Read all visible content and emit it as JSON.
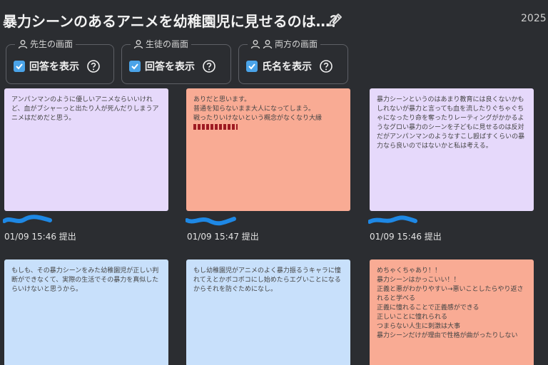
{
  "header": {
    "title": "暴力シーンのあるアニメを幼稚園児に見せるのは…？",
    "year": "2025"
  },
  "view_groups": [
    {
      "legend": "先生の画面",
      "option": "回答を表示",
      "checked": true
    },
    {
      "legend": "生徒の画面",
      "option": "回答を表示",
      "checked": true
    },
    {
      "legend": "両方の画面",
      "option": "氏名を表示",
      "checked": true
    }
  ],
  "cards": [
    {
      "color": "lavender",
      "text": "アンパンマンのように優しいアニメならいいけれど、血がブシャーっと出たり人が死んだりしまうアニメはだめだと思う。",
      "submitted": "01/09 15:46 提出"
    },
    {
      "color": "salmon",
      "text": "ありだと思います。\n普通を知らないまま大人になってしまう。\n戦ったりいけないという概念がなくなり大縁",
      "submitted": "01/09 15:47 提出"
    },
    {
      "color": "lavender",
      "text": "暴力シーンというのはあまり教育には良くないかもしれないが暴力と言っても血を流したりぐちゃぐちゃになったり命を奪ったりレーティングがかかるようなグロい暴力のシーンを子どもに見せるのは反対だがアンパンマンのようなすこし殴ばすくらいの暴力なら良いのではないかと私は考える。",
      "submitted": "01/09 15:46 提出"
    },
    {
      "color": "blue",
      "text": "もしも、その暴力シーンをみた幼稚園児が正しい判断ができなくて、実際の生活でその暴力を真似したらいけないと思うから。"
    },
    {
      "color": "blue",
      "text": "もし幼稚園児がアニメのよく暴力振るうキャラに憧れてえとかボコボコにし始めたらエグいことになるからそれを防ぐためになし。"
    },
    {
      "color": "salmon",
      "text": "めちゃくちゃあり！！\n暴力シーンはかっこいい！！\n正義と悪がわかりやすい→悪いことしたらやり返されると学べる\n正義に憧れることで正義感ができる\n正しいことに憧れられる\nつまらない人生に刺激は大事\n暴力シーンだけが理由で性格が曲がったりしない"
    }
  ]
}
